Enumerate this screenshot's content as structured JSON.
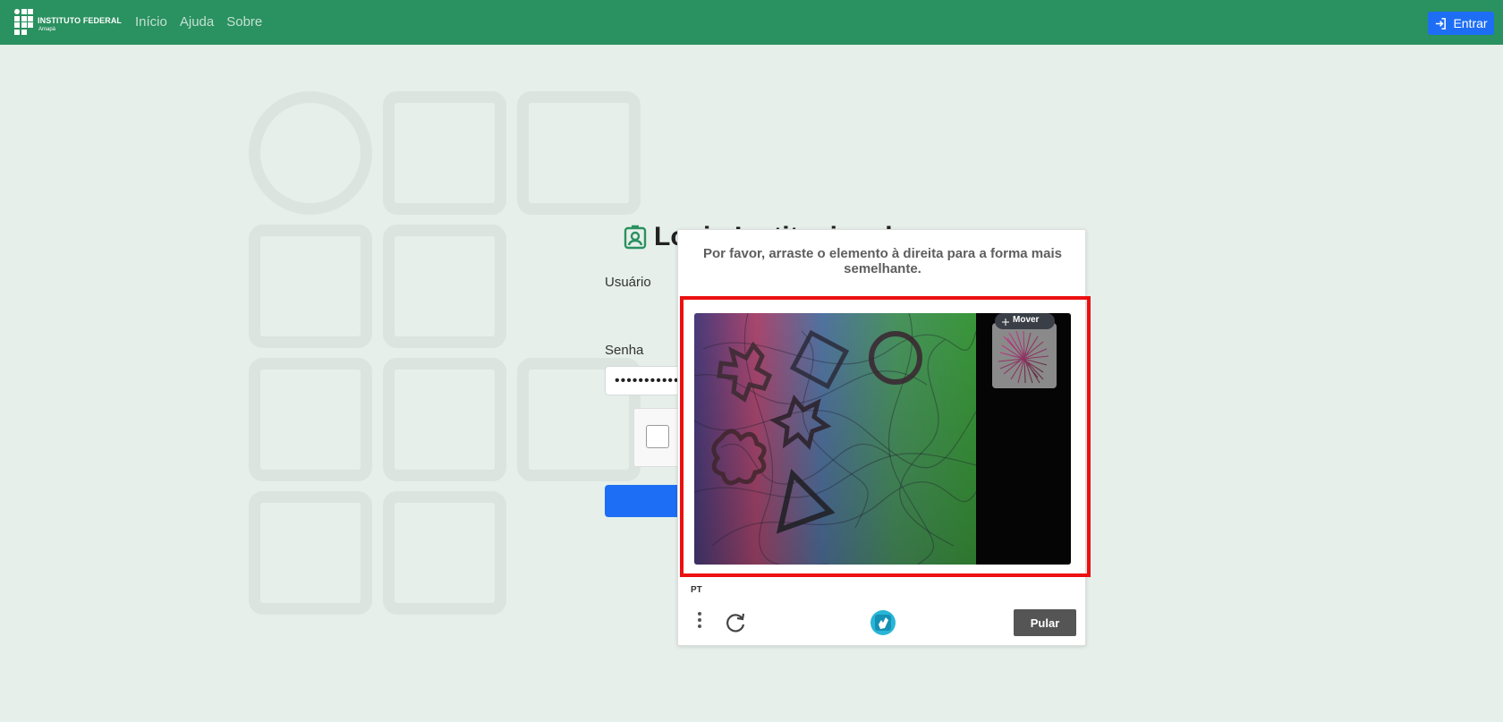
{
  "navbar": {
    "brand_title": "INSTITUTO FEDERAL",
    "brand_subtitle": "Amapá",
    "links": [
      "Início",
      "Ajuda",
      "Sobre"
    ],
    "login_button": "Entrar",
    "accent": "#2a9160",
    "button_color": "#1d6ef5"
  },
  "login": {
    "title_visible": "Login Institucional",
    "username_label": "Usuário",
    "password_label": "Senha",
    "password_value": "•••••••••••",
    "icon": "person-badge-icon"
  },
  "captcha": {
    "prompt": "Por favor, arraste o elemento à direita para a forma mais semelhante.",
    "move_label": "Mover",
    "language": "PT",
    "skip_button": "Pular",
    "highlight_color": "#ec1010"
  }
}
